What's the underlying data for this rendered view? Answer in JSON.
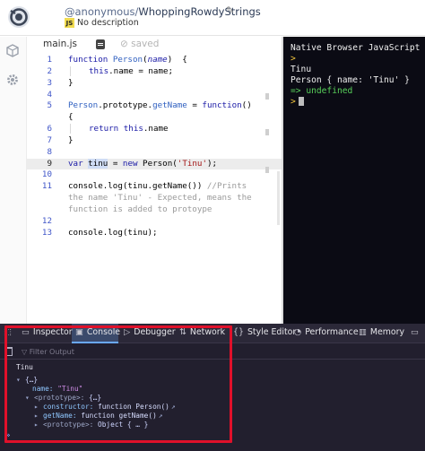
{
  "header": {
    "user": "@anonymous",
    "separator": "/",
    "repl_name": "WhoppingRowdyStrings",
    "js_badge": "JS",
    "description": "No description"
  },
  "editor": {
    "tab_label": "main.js",
    "saved_label": "saved",
    "lines": [
      {
        "n": "1"
      },
      {
        "n": "2"
      },
      {
        "n": "3"
      },
      {
        "n": "4"
      },
      {
        "n": "5"
      },
      {
        "n": ""
      },
      {
        "n": "6"
      },
      {
        "n": "7"
      },
      {
        "n": "8"
      },
      {
        "n": "9"
      },
      {
        "n": "10"
      },
      {
        "n": "11"
      },
      {
        "n": ""
      },
      {
        "n": ""
      },
      {
        "n": "12"
      },
      {
        "n": "13"
      }
    ],
    "code": {
      "l1_kw": "function",
      "l1_name": "Person",
      "l1_param": "name",
      "l1_rest": ")  {",
      "l2_this": "this",
      "l2_rest": ".name = name;",
      "l3": "}",
      "l5_a": "Person",
      "l5_b": ".prototype.",
      "l5_c": "getName",
      "l5_d": " = ",
      "l5_e": "function",
      "l5_f": "()",
      "l5b": "{",
      "l6_kw": "return",
      "l6_this": "this",
      "l6_rest": ".name",
      "l7": "}",
      "l9_kw": "var",
      "l9_var": "tinu",
      "l9_eq": " = ",
      "l9_new": "new",
      "l9_cls": " Person(",
      "l9_str": "'Tinu'",
      "l9_end": ");",
      "l11_code": "console.log(tinu.getName()) ",
      "l11_cm1": "//Prints",
      "l11_cm2": "the name 'Tinu' - Expected, means the",
      "l11_cm3": "function is added to protoype",
      "l13": "console.log(tinu);"
    }
  },
  "console": {
    "title": "Native Browser JavaScript",
    "prompt": ">",
    "out1": "Tinu",
    "out2": "Person { name: 'Tinu' }",
    "out3": "=> undefined",
    "prompt2": ">"
  },
  "devtools": {
    "tabs": {
      "inspector": "Inspector",
      "console": "Console",
      "debugger": "Debugger",
      "network": "Network",
      "style_editor": "Style Editor",
      "performance": "Performance",
      "memory": "Memory"
    },
    "filter_placeholder": "Filter Output",
    "output": {
      "log": "Tinu",
      "obj": "{…}",
      "name_key": "name:",
      "name_val": "\"Tinu\"",
      "proto_key": "<prototype>:",
      "proto_val": "{…}",
      "ctor_key": "constructor:",
      "ctor_val": "function Person()",
      "getname_key": "getName:",
      "getname_val": "function getName()",
      "proto2_key": "<prototype>:",
      "proto2_val": "Object { … }"
    },
    "input_prompt": "»"
  }
}
